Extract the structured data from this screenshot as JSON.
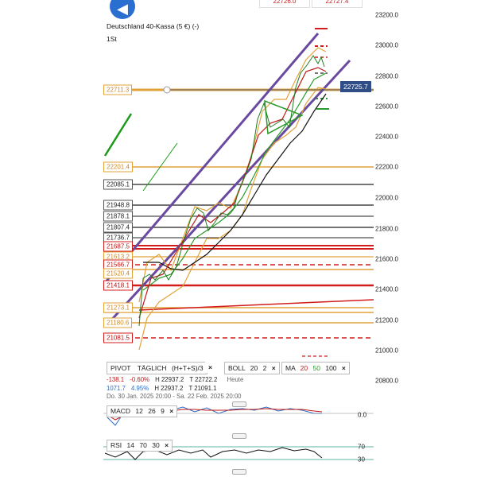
{
  "header": {
    "instrument": "Deutschland 40-Kassa (5 €) (-)",
    "timeframe": "1St",
    "top_tabs": [
      "22726.0",
      "22727.4"
    ]
  },
  "current_price": "22725.7",
  "price_axis_labels": [
    "23200.0",
    "23000.0",
    "22800.0",
    "22600.0",
    "22400.0",
    "22200.0",
    "22000.0",
    "21800.0",
    "21600.0",
    "21400.0",
    "21200.0",
    "21000.0",
    "20800.0"
  ],
  "levels": [
    {
      "value": "22711.3",
      "color": "orange"
    },
    {
      "value": "22201.4",
      "color": "orange"
    },
    {
      "value": "22085.1",
      "color": "dark"
    },
    {
      "value": "21948.8",
      "color": "dark"
    },
    {
      "value": "21878.1",
      "color": "dark"
    },
    {
      "value": "21807.4",
      "color": "dark"
    },
    {
      "value": "21736.7",
      "color": "dark"
    },
    {
      "value": "21687.5",
      "color": "red"
    },
    {
      "value": "21613.2",
      "color": "orange"
    },
    {
      "value": "21566.7",
      "color": "red"
    },
    {
      "value": "21520.4",
      "color": "orange"
    },
    {
      "value": "21418.1",
      "color": "red"
    },
    {
      "value": "21273.1",
      "color": "orange"
    },
    {
      "value": "21180.6",
      "color": "orange"
    },
    {
      "value": "21081.5",
      "color": "red"
    }
  ],
  "indicators": {
    "pivot": {
      "label": "PIVOT",
      "mode": "TÄGLICH",
      "params": "(H+T+S)/3",
      "close": "×"
    },
    "boll": {
      "label": "BOLL",
      "p1": "20",
      "p2": "2",
      "close": "×"
    },
    "ma": {
      "label": "MA",
      "p1": "20",
      "p2": "50",
      "p3": "100",
      "close": "×"
    }
  },
  "stats": {
    "change_abs": "-138.1",
    "change_pct": "-0.60%",
    "high": "H 22937.2",
    "low": "T 22722.2",
    "period": "Heute",
    "change2_abs": "1071.7",
    "change2_pct": "4.95%",
    "high2": "H 22937.2",
    "low2": "T 21091.1",
    "range": "Do. 30 Jan. 2025 20:00 - Sa. 22 Feb. 2025 20:00"
  },
  "macd": {
    "label": "MACD",
    "p1": "12",
    "p2": "26",
    "p3": "9",
    "close": "×",
    "axis": "0.0"
  },
  "rsi": {
    "label": "RSI",
    "p1": "14",
    "p2": "70",
    "p3": "30",
    "close": "×",
    "axis_high": "70",
    "axis_low": "30"
  },
  "colors": {
    "accent": "#2a6fd0",
    "price_badge": "#2f4d87",
    "orange": "#e2a23a",
    "red": "#d21c1c",
    "channel": "#6a4aa0"
  }
}
